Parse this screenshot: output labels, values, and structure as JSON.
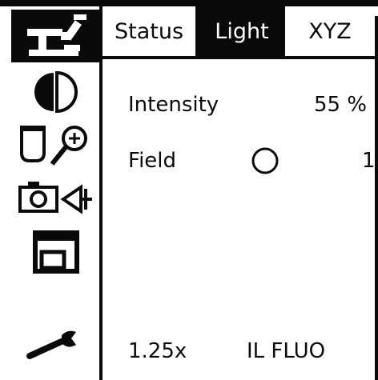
{
  "sidebar": {
    "items": [
      {
        "icon": "microscope-icon",
        "active": true
      },
      {
        "icon": "light-contrast-icon"
      },
      {
        "icon": "objective-magnifier-icon"
      },
      {
        "icon": "camera-eyepiece-icon"
      },
      {
        "icon": "window-icon"
      },
      {
        "icon": "wrench-icon"
      }
    ]
  },
  "tabs": [
    {
      "label": "Status"
    },
    {
      "label": "Light",
      "active": true
    },
    {
      "label": "XYZ"
    }
  ],
  "light_panel": {
    "intensity_label": "Intensity",
    "intensity_value": "55 %",
    "field_label": "Field",
    "field_value": "1"
  },
  "status_bar": {
    "magnification": "1.25x",
    "mode": "IL FLUO"
  }
}
